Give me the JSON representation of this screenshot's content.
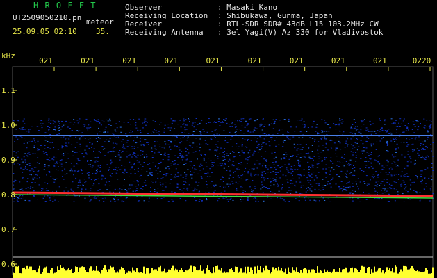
{
  "header": {
    "title": "H R O F F T",
    "filename": "UT2509050210.pn",
    "detection": "meteor",
    "timestamp": "25.09.05 02:10",
    "seconds": "35.",
    "fields": [
      {
        "key": "Observer",
        "value": ": Masaki Kano"
      },
      {
        "key": "Receiving Location",
        "value": ": Shibukawa, Gunma, Japan"
      },
      {
        "key": "Receiver",
        "value": ": RTL-SDR SDR# 43dB L15 103.2MHz CW"
      },
      {
        "key": "Receiving Antenna",
        "value": ": 3el Yagi(V) Az 330 for Vladivostok"
      }
    ]
  },
  "chart_data": {
    "type": "heatmap",
    "ylabel": "kHz",
    "yticks": [
      "1.1",
      "1.0",
      "0.9",
      "0.8",
      "0.7",
      "0.6"
    ],
    "xticks": [
      "021",
      "021",
      "021",
      "021",
      "021",
      "021",
      "021",
      "021",
      "021",
      "0220"
    ],
    "ylim": [
      0.6,
      1.15
    ],
    "xlim": [
      0,
      10
    ],
    "signal_band_khz": [
      0.8,
      1.02
    ],
    "carrier_khz": 0.81,
    "colors": {
      "axis": "#e8e84a",
      "noise": "#1030c0",
      "carrier": "#ff3030",
      "amplitude": "#ffff30"
    }
  }
}
